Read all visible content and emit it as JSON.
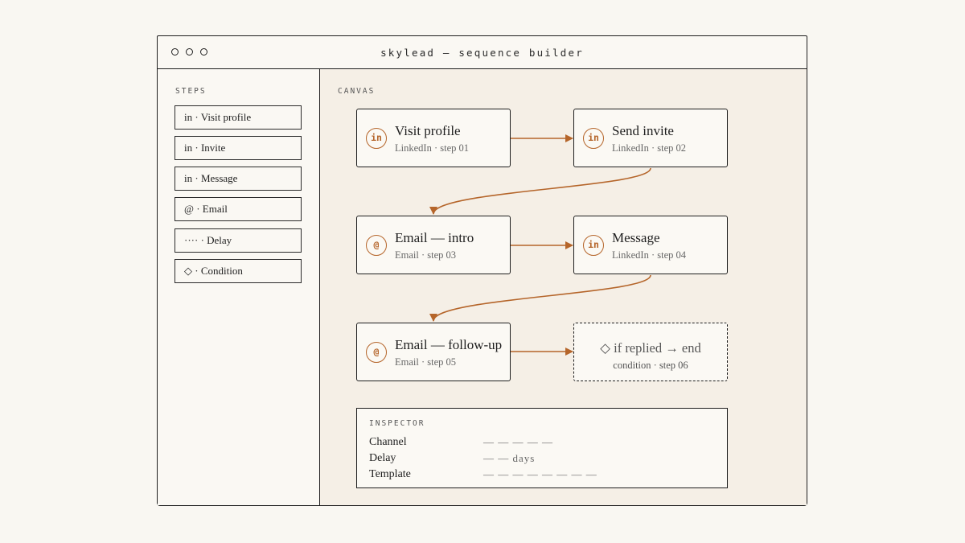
{
  "window": {
    "title": "skylead — sequence builder"
  },
  "sidebar": {
    "label": "STEPS",
    "items": [
      {
        "label": "in · Visit profile"
      },
      {
        "label": "in · Invite"
      },
      {
        "label": "in · Message"
      },
      {
        "label": "@ · Email"
      },
      {
        "label": "···· · Delay"
      },
      {
        "label": "◇ · Condition"
      }
    ]
  },
  "canvas": {
    "label": "CANVAS",
    "nodes": [
      {
        "icon": "linkedin-icon",
        "glyph": "in",
        "title": "Visit profile",
        "subtitle": "LinkedIn · step 01"
      },
      {
        "icon": "linkedin-icon",
        "glyph": "in",
        "title": "Send invite",
        "subtitle": "LinkedIn · step 02"
      },
      {
        "icon": "email-icon",
        "glyph": "@",
        "title": "Email — intro",
        "subtitle": "Email · step 03"
      },
      {
        "icon": "linkedin-icon",
        "glyph": "in",
        "title": "Message",
        "subtitle": "LinkedIn · step 04"
      },
      {
        "icon": "email-icon",
        "glyph": "@",
        "title": "Email — follow-up",
        "subtitle": "Email · step 05"
      }
    ],
    "condition": {
      "title": "◇ if replied → end",
      "subtitle": "condition · step 06"
    },
    "accent_color": "#b5652a"
  },
  "inspector": {
    "label": "INSPECTOR",
    "rows": [
      {
        "key": "Channel",
        "value": "— — — — —"
      },
      {
        "key": "Delay",
        "value": "— — days"
      },
      {
        "key": "Template",
        "value": "— — — — — — — —"
      }
    ]
  }
}
